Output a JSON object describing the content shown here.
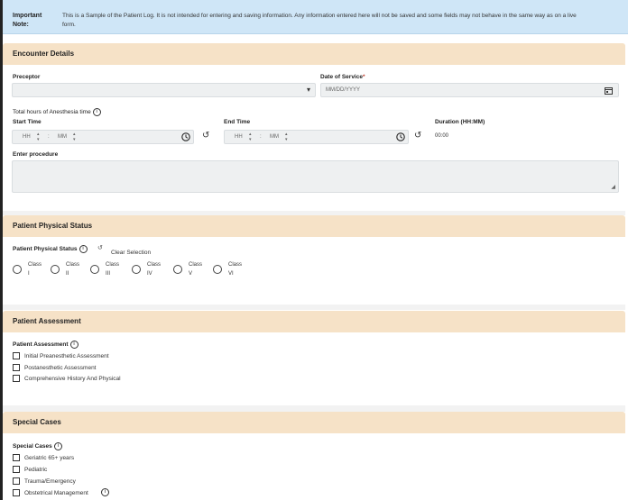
{
  "notice": {
    "label_line1": "Important",
    "label_line2": "Note:",
    "text_line1": "This is a Sample of the Patient Log. It is not intended for entering and saving information. Any information entered here will not be saved and some fields may not behave in the same way as on a live",
    "text_line2": "form."
  },
  "encounter": {
    "title": "Encounter Details",
    "preceptor_label": "Preceptor",
    "date_label": "Date of Service",
    "date_required": "*",
    "date_placeholder": "MM/DD/YYYY",
    "anesthesia_label": "Total hours of Anesthesia time",
    "start_label": "Start Time",
    "end_label": "End Time",
    "duration_label": "Duration (HH:MM)",
    "duration_value": "00:00",
    "hh": "HH",
    "mm": "MM",
    "colon": ":",
    "procedure_label": "Enter procedure"
  },
  "physical": {
    "title": "Patient Physical Status",
    "field_label": "Patient Physical Status",
    "clear_label": "Clear Selection",
    "options": [
      {
        "top": "Class",
        "bottom": "I"
      },
      {
        "top": "Class",
        "bottom": "II"
      },
      {
        "top": "Class",
        "bottom": "III"
      },
      {
        "top": "Class",
        "bottom": "IV"
      },
      {
        "top": "Class",
        "bottom": "V"
      },
      {
        "top": "Class",
        "bottom": "VI"
      }
    ]
  },
  "assessment": {
    "title": "Patient Assessment",
    "field_label": "Patient Assessment",
    "options": [
      "Initial Preanesthetic Assessment",
      "Postanesthetic Assessment",
      "Comprehensive History And Physical"
    ]
  },
  "special": {
    "title": "Special Cases",
    "field_label": "Special Cases",
    "options": [
      "Geriatric 65+ years",
      "Pediatric",
      "Trauma/Emergency",
      "Obstetrical Management"
    ]
  },
  "icons": {
    "info": "i",
    "chevron": "▾",
    "undo": "↺"
  }
}
